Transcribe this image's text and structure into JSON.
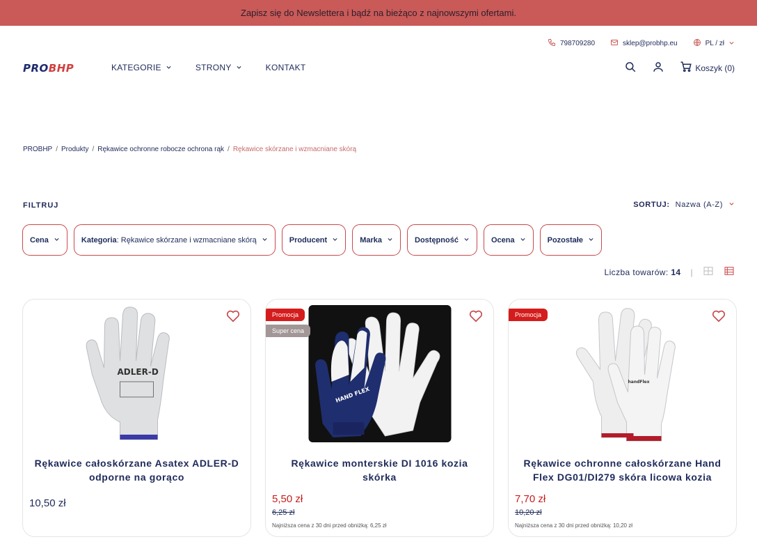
{
  "banner": {
    "text": "Zapisz się do Newslettera i bądź na bieżąco z najnowszymi ofertami."
  },
  "topbar": {
    "phone": "798709280",
    "email": "sklep@probhp.eu",
    "locale": "PL / zł"
  },
  "logo": {
    "part1": "PRO",
    "part2": "BHP"
  },
  "nav": {
    "items": [
      {
        "label": "KATEGORIE"
      },
      {
        "label": "STRONY"
      },
      {
        "label": "KONTAKT"
      }
    ]
  },
  "header": {
    "cart_label": "Koszyk (0)"
  },
  "breadcrumb": [
    "PROBHP",
    "Produkty",
    "Rękawice ochronne robocze ochrona rąk",
    "Rękawice skórzane i wzmacniane skórą"
  ],
  "filters": {
    "title": "FILTRUJ",
    "sort_label": "SORTUJ:",
    "sort_value": "Nazwa (A-Z)",
    "chips": [
      {
        "label": "Cena",
        "value": ""
      },
      {
        "label": "Kategoria",
        "value": ": Rękawice skórzane i wzmacniane skórą"
      },
      {
        "label": "Producent",
        "value": ""
      },
      {
        "label": "Marka",
        "value": ""
      },
      {
        "label": "Dostępność",
        "value": ""
      },
      {
        "label": "Ocena",
        "value": ""
      },
      {
        "label": "Pozostałe",
        "value": ""
      }
    ],
    "count_label": "Liczba towarów:",
    "count_value": "14"
  },
  "products": [
    {
      "name": "Rękawice całoskórzane Asatex ADLER-D odporne na gorąco",
      "price": "10,50 zł",
      "old_price": "",
      "lowest": "",
      "badges": [],
      "glove_text": "ADLER-D"
    },
    {
      "name": "Rękawice monterskie DI 1016 kozia skórka",
      "price": "5,50 zł",
      "old_price": "6,25 zł",
      "lowest": "Najniższa cena z 30 dni przed obniżką: 6,25 zł",
      "badges": [
        "Promocja",
        "Super cena"
      ],
      "glove_text": "HAND FLEX"
    },
    {
      "name": "Rękawice ochronne całoskórzane Hand Flex DG01/DI279 skóra licowa kozia",
      "price": "7,70 zł",
      "old_price": "10,20 zł",
      "lowest": "Najniższa cena z 30 dni przed obniżką: 10,20 zł",
      "badges": [
        "Promocja"
      ],
      "glove_text": "handFlex"
    }
  ],
  "colors": {
    "accent": "#c8494a",
    "navy": "#1f2a5a",
    "banner": "#c95a58",
    "sale": "#c81d1d"
  }
}
